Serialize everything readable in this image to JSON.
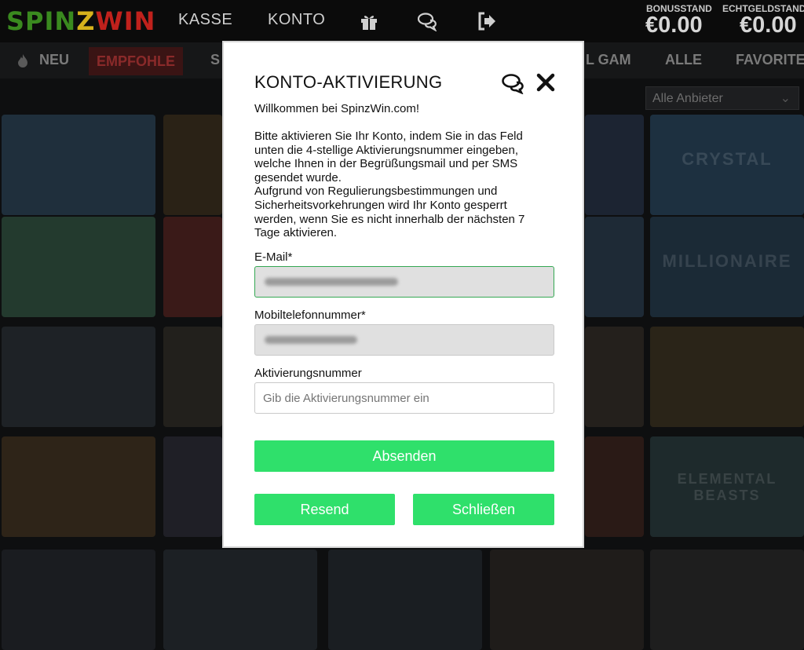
{
  "header": {
    "logo": {
      "part1": "SPIN",
      "part2": "Z",
      "part3": "WIN"
    },
    "nav": [
      {
        "label": "KASSE"
      },
      {
        "label": "KONTO"
      }
    ],
    "icons": [
      "gift-icon",
      "chat-icon",
      "logout-icon"
    ],
    "bonus": {
      "label": "BONUSSTAND",
      "value": "€0.00"
    },
    "real": {
      "label": "ECHTGELDSTAND",
      "value": "€0.00"
    }
  },
  "categories": [
    {
      "label": "NEU"
    },
    {
      "label": "EMPFOHLE"
    },
    {
      "label": "S"
    },
    {
      "label": "L GAM"
    },
    {
      "label": "ALLE"
    },
    {
      "label": "FAVORITE"
    }
  ],
  "provider_select": {
    "value": "Alle Anbieter"
  },
  "games": [
    {
      "title": "CRYSTAL"
    },
    {
      "title": "MILLIONAIRE"
    },
    {
      "title": "ELEMENTAL BEASTS"
    }
  ],
  "modal": {
    "title": "KONTO-AKTIVIERUNG",
    "welcome": "Willkommen bei SpinzWin.com!",
    "body": "Bitte aktivieren Sie Ihr Konto, indem Sie in das Feld\nunten die 4-stellige Aktivierungsnummer eingeben,\nwelche Ihnen in der Begrüßungsmail und per SMS\ngesendet wurde.\nAufgrund von Regulierungsbestimmungen und\nSicherheitsvorkehrungen wird Ihr Konto gesperrt\nwerden, wenn Sie es nicht innerhalb der nächsten 7\nTage aktivieren.",
    "email_label": "E-Mail*",
    "phone_label": "Mobiltelefonnummer*",
    "code_label": "Aktivierungsnummer",
    "code_placeholder": "Gib die Aktivierungsnummer ein",
    "submit_label": "Absenden",
    "resend_label": "Resend",
    "close_label": "Schließen",
    "accent_color": "#2fe06b"
  }
}
